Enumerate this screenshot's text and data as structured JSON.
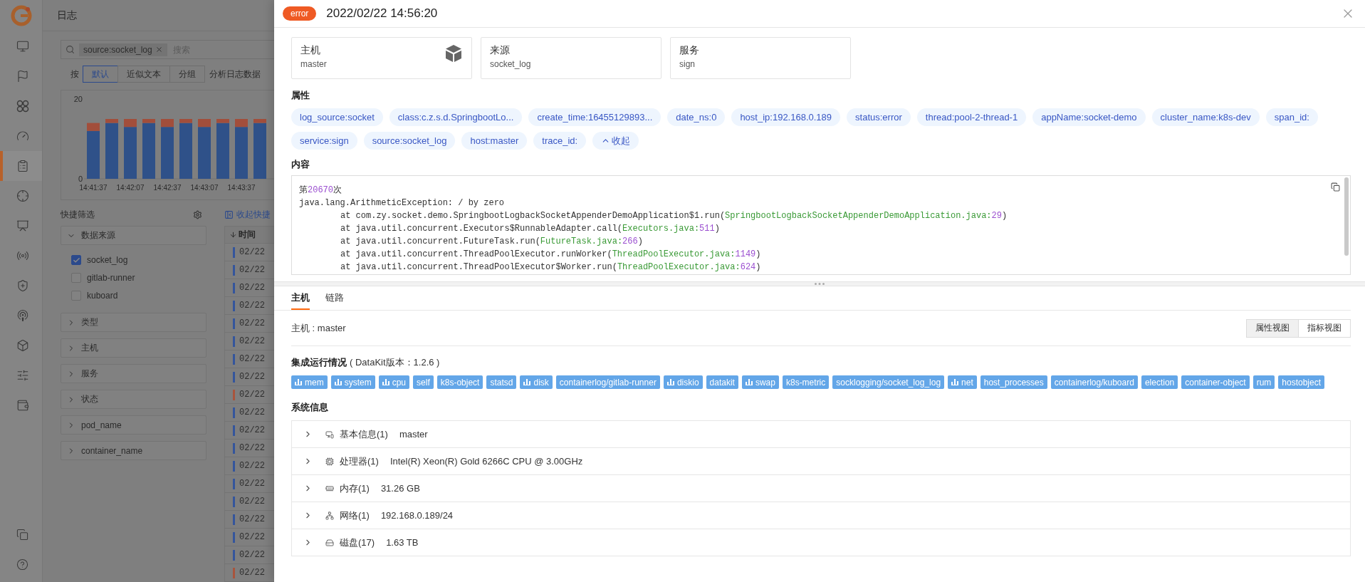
{
  "nav": {
    "items": [
      {
        "selected": false
      },
      {
        "selected": false
      },
      {
        "selected": false
      },
      {
        "selected": false
      },
      {
        "selected": true
      },
      {
        "selected": false
      },
      {
        "selected": false
      },
      {
        "selected": false
      },
      {
        "selected": false
      },
      {
        "selected": false
      },
      {
        "selected": false
      },
      {
        "selected": false
      },
      {
        "selected": false
      }
    ]
  },
  "page": {
    "title": "日志",
    "search": {
      "tag": "source:socket_log",
      "placeholder": "搜索"
    },
    "group_by": {
      "label": "按",
      "options": [
        {
          "label": "默认",
          "selected": true
        },
        {
          "label": "近似文本",
          "selected": false
        },
        {
          "label": "分组",
          "selected": false
        }
      ],
      "analyze": "分析日志数据"
    },
    "chart_data": {
      "type": "bar",
      "stacked": true,
      "categories": [
        "14:41:37",
        null,
        "14:42:07",
        null,
        "14:42:37",
        null,
        "14:43:07",
        null,
        "14:43:37",
        null
      ],
      "ylim": [
        0,
        20
      ],
      "yticks": [
        0,
        20
      ],
      "series": [
        {
          "color": "#2f5189",
          "values": [
            12,
            14,
            13,
            14,
            13,
            14,
            13,
            14,
            13,
            14
          ]
        },
        {
          "color": "#a24e3b",
          "values": [
            2,
            1,
            2,
            1,
            2,
            1,
            2,
            1,
            2,
            1
          ]
        }
      ]
    },
    "quick_filter": {
      "title": "快捷筛选",
      "collapse_link": "收起快捷",
      "groups": [
        {
          "label": "数据来源",
          "expanded": true,
          "options": [
            {
              "label": "socket_log",
              "checked": true
            },
            {
              "label": "gitlab-runner",
              "checked": false
            },
            {
              "label": "kuboard",
              "checked": false
            }
          ]
        },
        {
          "label": "类型",
          "expanded": false
        },
        {
          "label": "主机",
          "expanded": false
        },
        {
          "label": "服务",
          "expanded": false
        },
        {
          "label": "状态",
          "expanded": false
        },
        {
          "label": "pod_name",
          "expanded": false
        },
        {
          "label": "container_name",
          "expanded": false
        }
      ]
    },
    "table": {
      "column": "时间",
      "rows": [
        {
          "time": "02/22",
          "color": "#34559c"
        },
        {
          "time": "02/22",
          "color": "#34559c"
        },
        {
          "time": "02/22",
          "color": "#34559c"
        },
        {
          "time": "02/22",
          "color": "#34559c"
        },
        {
          "time": "02/22",
          "color": "#34559c"
        },
        {
          "time": "02/22",
          "color": "#34559c"
        },
        {
          "time": "02/22",
          "color": "#34559c"
        },
        {
          "time": "02/22",
          "color": "#34559c"
        },
        {
          "time": "02/22",
          "color": "#a9543c"
        },
        {
          "time": "02/22",
          "color": "#34559c"
        },
        {
          "time": "02/22",
          "color": "#34559c"
        },
        {
          "time": "02/22",
          "color": "#34559c"
        },
        {
          "time": "02/22",
          "color": "#34559c"
        },
        {
          "time": "02/22",
          "color": "#34559c"
        },
        {
          "time": "02/22",
          "color": "#34559c"
        },
        {
          "time": "02/22",
          "color": "#34559c"
        },
        {
          "time": "02/22",
          "color": "#34559c"
        },
        {
          "time": "02/22",
          "color": "#34559c"
        },
        {
          "time": "02/22",
          "color": "#a9543c"
        }
      ]
    }
  },
  "drawer": {
    "status": "error",
    "time": "2022/02/22 14:56:20",
    "cards": [
      {
        "label": "主机",
        "value": "master"
      },
      {
        "label": "来源",
        "value": "socket_log"
      },
      {
        "label": "服务",
        "value": "sign"
      }
    ],
    "attributes_title": "属性",
    "attributes": [
      "log_source:socket",
      "class:c.z.s.d.SpringbootLo...",
      "create_time:16455129893...",
      "date_ns:0",
      "host_ip:192.168.0.189",
      "status:error",
      "thread:pool-2-thread-1",
      "appName:socket-demo",
      "cluster_name:k8s-dev",
      "span_id:",
      "service:sign",
      "source:socket_log",
      "host:master",
      "trace_id:"
    ],
    "collapse_button": "收起",
    "content_title": "内容",
    "content_lines": [
      {
        "kind": "text",
        "parts": [
          {
            "text": "第",
            "kind": "plain"
          },
          {
            "text": "20670",
            "kind": "number"
          },
          {
            "text": "次",
            "kind": "plain"
          }
        ]
      },
      {
        "kind": "text",
        "parts": [
          {
            "text": "java.lang.ArithmeticException: / by zero",
            "kind": "plain"
          }
        ]
      },
      {
        "kind": "frame",
        "parts": [
          {
            "text": "at com.zy.socket.demo.SpringbootLogbackSocketAppenderDemoApplication$1.run(",
            "kind": "plain"
          },
          {
            "text": "SpringbootLogbackSocketAppenderDemoApplication.java:",
            "kind": "file"
          },
          {
            "text": "29",
            "kind": "number"
          },
          {
            "text": ")",
            "kind": "plain"
          }
        ]
      },
      {
        "kind": "frame",
        "parts": [
          {
            "text": "at java.util.concurrent.Executors$RunnableAdapter.call(",
            "kind": "plain"
          },
          {
            "text": "Executors.java:",
            "kind": "file"
          },
          {
            "text": "511",
            "kind": "number"
          },
          {
            "text": ")",
            "kind": "plain"
          }
        ]
      },
      {
        "kind": "frame",
        "parts": [
          {
            "text": "at java.util.concurrent.FutureTask.run(",
            "kind": "plain"
          },
          {
            "text": "FutureTask.java:",
            "kind": "file"
          },
          {
            "text": "266",
            "kind": "number"
          },
          {
            "text": ")",
            "kind": "plain"
          }
        ]
      },
      {
        "kind": "frame",
        "parts": [
          {
            "text": "at java.util.concurrent.ThreadPoolExecutor.runWorker(",
            "kind": "plain"
          },
          {
            "text": "ThreadPoolExecutor.java:",
            "kind": "file"
          },
          {
            "text": "1149",
            "kind": "number"
          },
          {
            "text": ")",
            "kind": "plain"
          }
        ]
      },
      {
        "kind": "frame",
        "parts": [
          {
            "text": "at java.util.concurrent.ThreadPoolExecutor$Worker.run(",
            "kind": "plain"
          },
          {
            "text": "ThreadPoolExecutor.java:",
            "kind": "file"
          },
          {
            "text": "624",
            "kind": "number"
          },
          {
            "text": ")",
            "kind": "plain"
          }
        ]
      }
    ],
    "tabs": [
      {
        "label": "主机",
        "selected": true
      },
      {
        "label": "链路",
        "selected": false
      }
    ],
    "host_line": "主机 : master",
    "views": [
      {
        "label": "属性视图",
        "selected": true
      },
      {
        "label": "指标视图",
        "selected": false
      }
    ],
    "integration": {
      "title": "集成运行情况",
      "version": "( DataKit版本：1.2.6 )",
      "items": [
        {
          "name": "mem",
          "kind": "metric"
        },
        {
          "name": "system",
          "kind": "metric"
        },
        {
          "name": "cpu",
          "kind": "metric"
        },
        {
          "name": "self",
          "kind": "plain"
        },
        {
          "name": "k8s-object",
          "kind": "plain"
        },
        {
          "name": "statsd",
          "kind": "plain"
        },
        {
          "name": "disk",
          "kind": "metric"
        },
        {
          "name": "containerlog/gitlab-runner",
          "kind": "plain"
        },
        {
          "name": "diskio",
          "kind": "metric"
        },
        {
          "name": "datakit",
          "kind": "plain"
        },
        {
          "name": "swap",
          "kind": "metric"
        },
        {
          "name": "k8s-metric",
          "kind": "plain"
        },
        {
          "name": "socklogging/socket_log_log",
          "kind": "plain"
        },
        {
          "name": "net",
          "kind": "metric"
        },
        {
          "name": "host_processes",
          "kind": "plain"
        },
        {
          "name": "containerlog/kuboard",
          "kind": "plain"
        },
        {
          "name": "election",
          "kind": "plain"
        },
        {
          "name": "container-object",
          "kind": "plain"
        },
        {
          "name": "rum",
          "kind": "plain"
        },
        {
          "name": "hostobject",
          "kind": "plain"
        }
      ]
    },
    "system_title": "系统信息",
    "system_rows": [
      {
        "label": "基本信息(1)",
        "value": "master",
        "expanded": false
      },
      {
        "label": "处理器(1)",
        "value": "Intel(R) Xeon(R) Gold 6266C CPU @ 3.00GHz",
        "expanded": false
      },
      {
        "label": "内存(1)",
        "value": "31.26 GB",
        "expanded": false
      },
      {
        "label": "网络(1)",
        "value": "192.168.0.189/24",
        "expanded": false
      },
      {
        "label": "磁盘(17)",
        "value": "1.63 TB",
        "expanded": false
      }
    ]
  }
}
